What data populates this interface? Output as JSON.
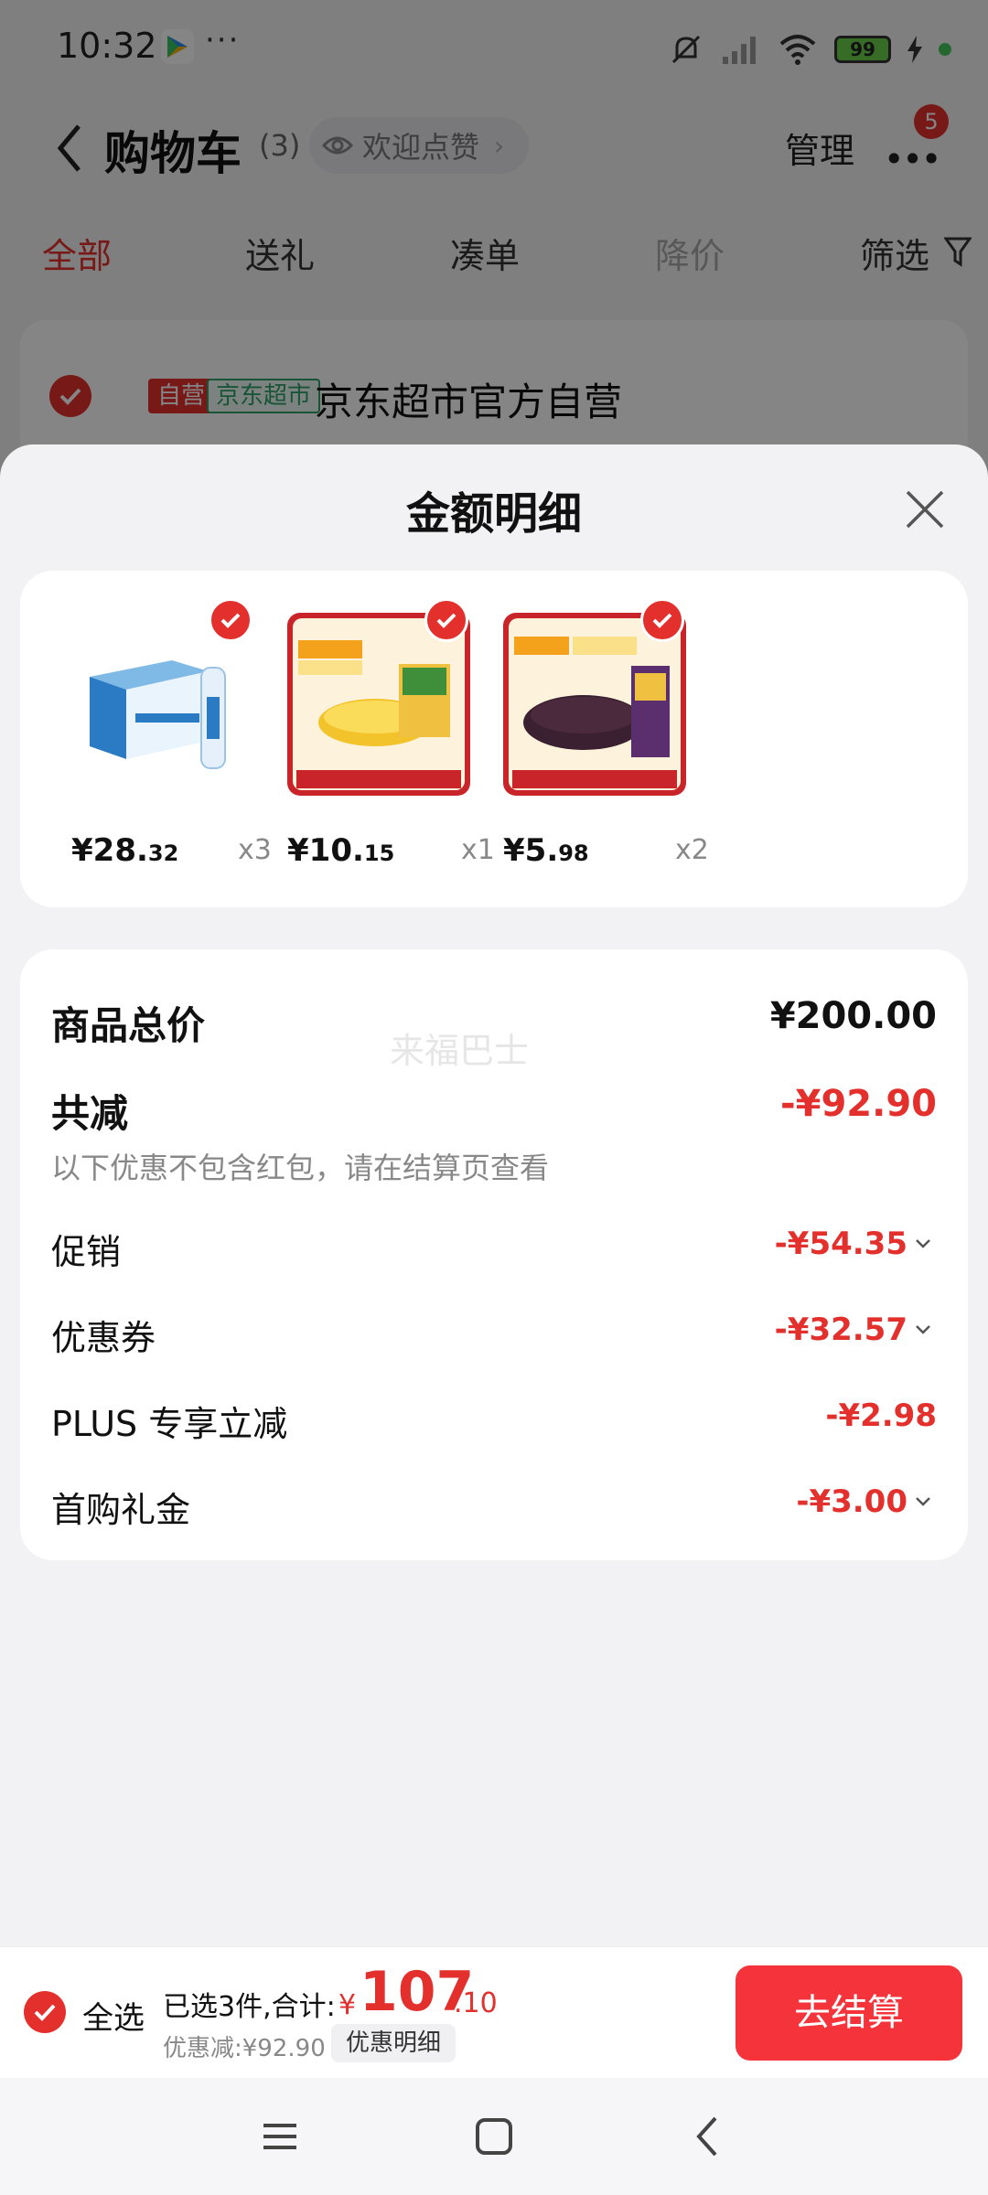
{
  "status_bar": {
    "time": "10:32",
    "dots": "···",
    "battery": "99"
  },
  "header": {
    "title": "购物车",
    "count": "(3)",
    "welcome": "欢迎点赞",
    "manage": "管理",
    "badge": "5"
  },
  "filter_tabs": [
    "全部",
    "送礼",
    "凑单",
    "降价",
    "筛选"
  ],
  "store": {
    "tag_self": "自营",
    "tag_jd": "京东超市",
    "name": "京东超市官方自营"
  },
  "sheet": {
    "title": "金额明细",
    "products": [
      {
        "price_int": "¥28.",
        "price_dec": "32",
        "qty": "x3",
        "image": "water-bottle-box"
      },
      {
        "price_int": "¥10.",
        "price_dec": "15",
        "qty": "x1",
        "image": "millet-rice-bag"
      },
      {
        "price_int": "¥5.",
        "price_dec": "98",
        "qty": "x2",
        "image": "black-rice-bag"
      }
    ],
    "summary": {
      "total_label": "商品总价",
      "total_value": "¥200.00",
      "reduce_label": "共减",
      "reduce_value": "-¥92.90",
      "note": "以下优惠不包含红包，请在结算页查看",
      "watermark": "来福巴士",
      "rows": [
        {
          "label": "促销",
          "value": "-¥54.35"
        },
        {
          "label": "优惠券",
          "value": "-¥32.57"
        },
        {
          "label": "PLUS 专享立减",
          "value": "-¥2.98"
        },
        {
          "label": "首购礼金",
          "value": "-¥3.00"
        }
      ]
    }
  },
  "checkout": {
    "select_all": "全选",
    "selected_text": "已选3件,合计:",
    "yen": "¥",
    "total_int": "107",
    "total_dec": ".10",
    "discount_text": "优惠减:¥92.90",
    "detail_btn": "优惠明细",
    "checkout_btn": "去结算"
  },
  "colors": {
    "accent": "#e3302c",
    "checkout_btn": "#f4333b",
    "jd_green": "#2fa26a"
  }
}
